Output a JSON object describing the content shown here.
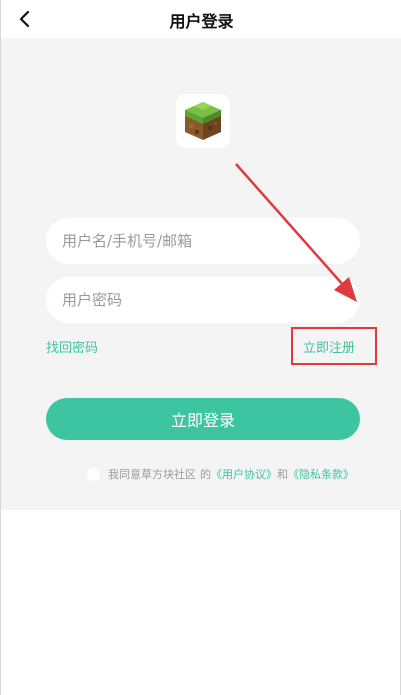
{
  "header": {
    "title": "用户登录",
    "back_icon": "chevron-left-icon"
  },
  "logo": {
    "icon": "grass-block-icon"
  },
  "form": {
    "username_placeholder": "用户名/手机号/邮箱",
    "password_placeholder": "用户密码",
    "forgot_label": "找回密码",
    "register_label": "立即注册",
    "login_label": "立即登录"
  },
  "agreement": {
    "prefix": "我同意草方块社区",
    "of": "的",
    "user_terms": "《用户协议》",
    "and": "和",
    "privacy_terms": "《隐私条款》"
  },
  "colors": {
    "accent": "#3cc5a0",
    "annotation": "#e0393e",
    "background": "#f4f4f4"
  }
}
